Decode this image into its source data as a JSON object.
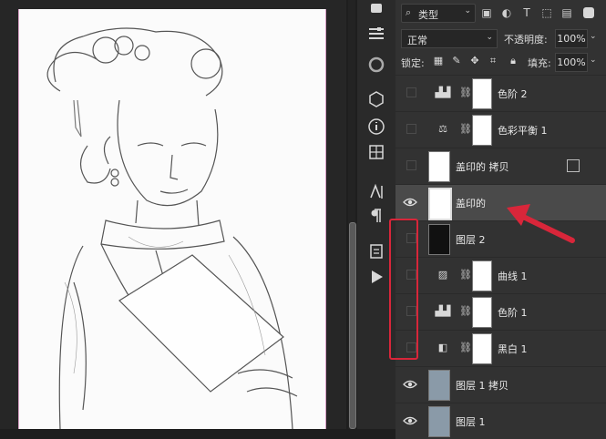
{
  "filter": {
    "icon": "search-icon",
    "label": "类型"
  },
  "filter_icons": [
    "image-filter-icon",
    "adjustment-filter-icon",
    "type-filter-icon",
    "shape-filter-icon",
    "smart-object-filter-icon"
  ],
  "filter_glyphs": [
    "▣",
    "◐",
    "T",
    "⬚",
    "▤"
  ],
  "blend": {
    "mode": "正常",
    "opacity_label": "不透明度:",
    "opacity_value": "100%"
  },
  "lock": {
    "label": "锁定:",
    "fill_label": "填充:",
    "fill_value": "100%"
  },
  "type_filter_label": "T",
  "layers": [
    {
      "name": "色阶 2",
      "kind": "levels"
    },
    {
      "name": "色彩平衡 1",
      "kind": "color-balance"
    },
    {
      "name": "盖印的 拷贝",
      "kind": "pixel"
    },
    {
      "name": "盖印的",
      "kind": "pixel",
      "selected": true
    },
    {
      "name": "图层 2",
      "kind": "dark"
    },
    {
      "name": "曲线 1",
      "kind": "curves"
    },
    {
      "name": "色阶 1",
      "kind": "levels"
    },
    {
      "name": "黑白 1",
      "kind": "black-white"
    },
    {
      "name": "图层 1 拷贝",
      "kind": "photo"
    },
    {
      "name": "图层 1",
      "kind": "photo"
    }
  ],
  "accent": "#d8263a"
}
